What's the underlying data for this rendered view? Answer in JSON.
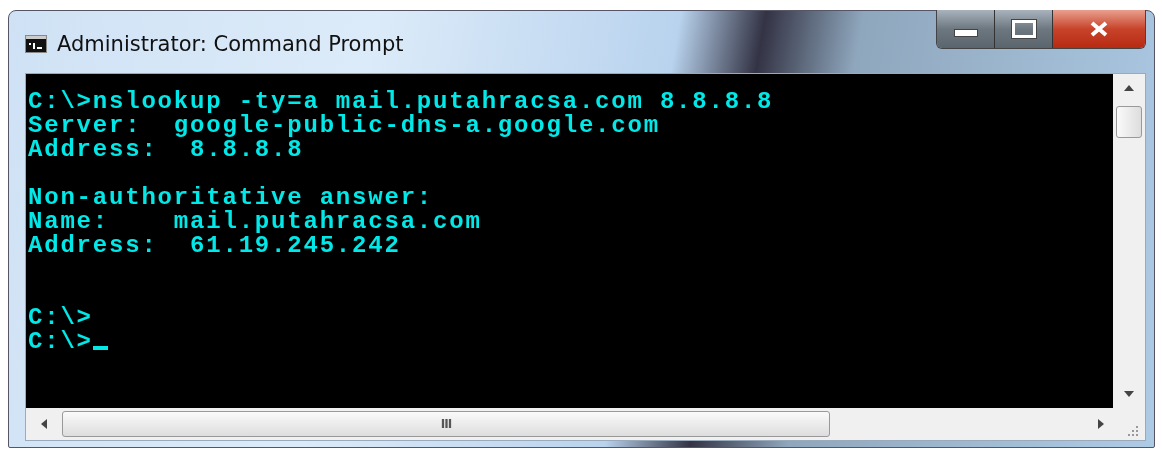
{
  "window": {
    "title": "Administrator: Command Prompt"
  },
  "console": {
    "blocks": [
      {
        "lines": [
          "C:\\>nslookup -ty=a mail.putahracsa.com 8.8.8.8",
          "Server:  google-public-dns-a.google.com",
          "Address:  8.8.8.8"
        ]
      },
      {
        "lines": [
          "Non-authoritative answer:",
          "Name:    mail.putahracsa.com",
          "Address:  61.19.245.242"
        ]
      },
      {
        "lines": [
          "C:\\>",
          "C:\\>"
        ]
      }
    ],
    "cursor": true
  },
  "scrollbar": {
    "thumb_label": "III"
  }
}
